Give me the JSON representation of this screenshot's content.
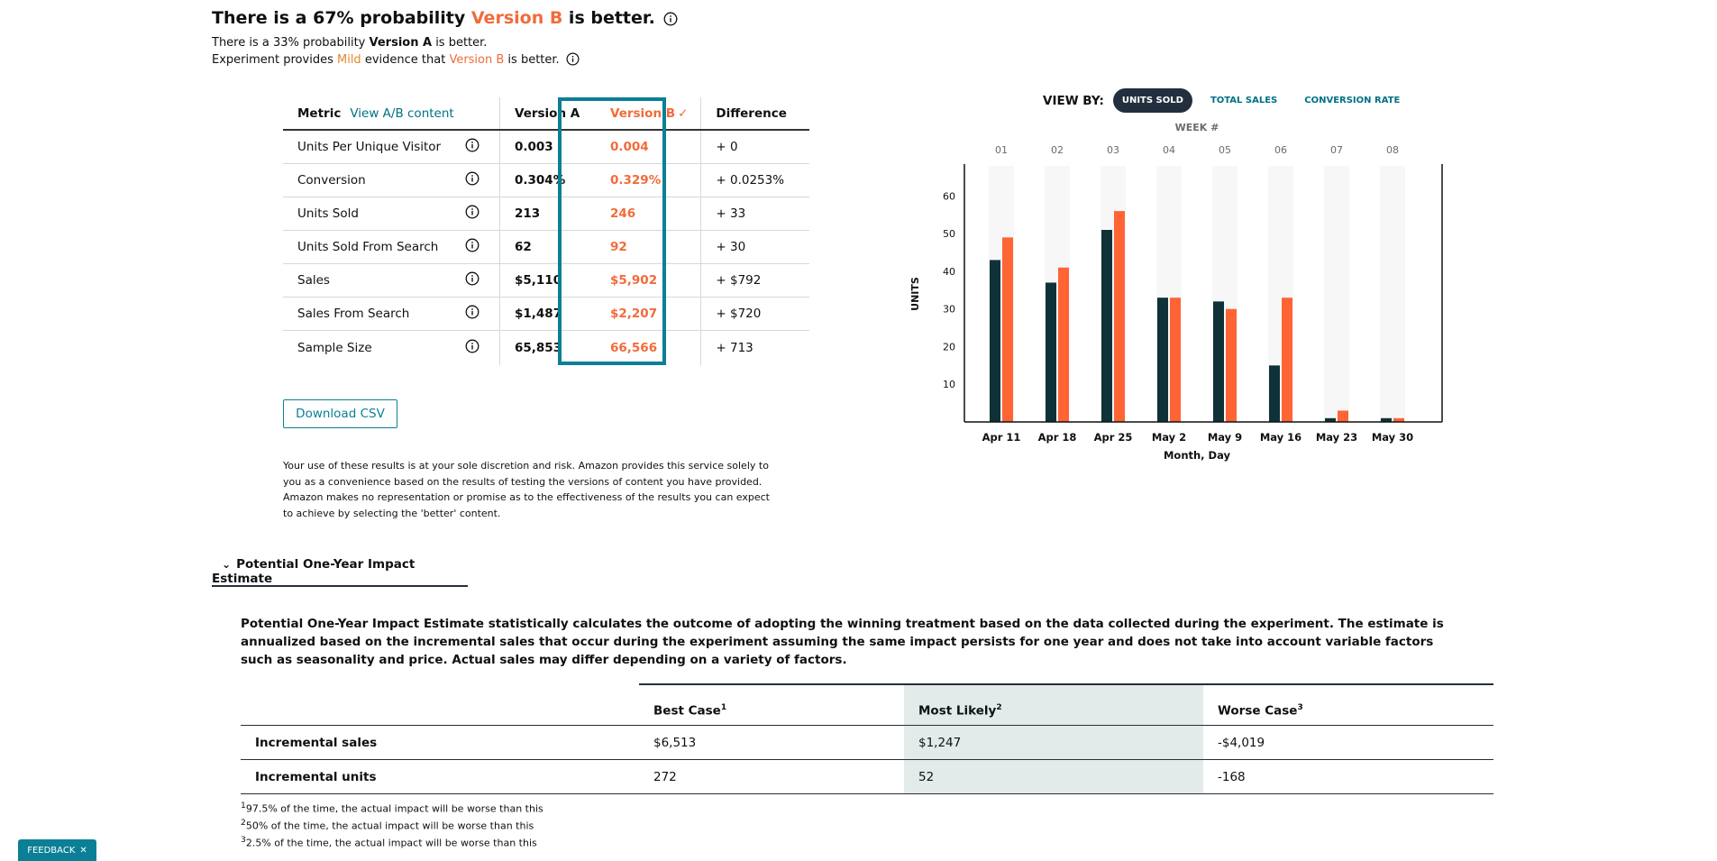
{
  "headline": {
    "part1": "There is a 67% probability ",
    "variant": "Version B",
    "part2": " is better."
  },
  "subline1": {
    "part1": "There is a 33% probability ",
    "variant": "Version A",
    "part2": " is better."
  },
  "subline2": {
    "part1": "Experiment provides ",
    "strength": "Mild",
    "part2": " evidence that ",
    "variant": "Version B",
    "part3": " is better."
  },
  "metrics": {
    "headers": {
      "metric": "Metric",
      "view_link": "View A/B content",
      "a": "Version A",
      "b": "Version B",
      "b_check": "✓",
      "diff": "Difference"
    },
    "rows": [
      {
        "name": "Units Per Unique Visitor",
        "a": "0.003",
        "b": "0.004",
        "diff": "+ 0"
      },
      {
        "name": "Conversion",
        "a": "0.304%",
        "b": "0.329%",
        "diff": "+ 0.0253%"
      },
      {
        "name": "Units Sold",
        "a": "213",
        "b": "246",
        "diff": "+ 33"
      },
      {
        "name": "Units Sold From Search",
        "a": "62",
        "b": "92",
        "diff": "+ 30"
      },
      {
        "name": "Sales",
        "a": "$5,110",
        "b": "$5,902",
        "diff": "+ $792"
      },
      {
        "name": "Sales From Search",
        "a": "$1,487",
        "b": "$2,207",
        "diff": "+ $720"
      },
      {
        "name": "Sample Size",
        "a": "65,853",
        "b": "66,566",
        "diff": "+ 713"
      }
    ]
  },
  "download_label": "Download CSV",
  "disclaimer": "Your use of these results is at your sole discretion and risk. Amazon provides this service solely to you as a convenience based on the results of testing the versions of content you have provided. Amazon makes no representation or promise as to the effectiveness of the results you can expect to achieve by selecting the 'better' content.",
  "view_by": {
    "label": "VIEW BY:",
    "options": [
      "UNITS SOLD",
      "TOTAL SALES",
      "CONVERSION RATE"
    ],
    "selected": "UNITS SOLD"
  },
  "colors": {
    "version_a": "#0e3238",
    "version_b": "#ff6435",
    "accent": "#0a7f96"
  },
  "chart_data": {
    "type": "bar",
    "top_axis_label": "WEEK #",
    "weeks": [
      "01",
      "02",
      "03",
      "04",
      "05",
      "06",
      "07",
      "08"
    ],
    "categories": [
      "Apr 11",
      "Apr 18",
      "Apr 25",
      "May 2",
      "May 9",
      "May 16",
      "May 23",
      "May 30"
    ],
    "series": [
      {
        "values": [
          43,
          37,
          51,
          33,
          32,
          15,
          1,
          1
        ]
      },
      {
        "values": [
          49,
          41,
          56,
          33,
          30,
          33,
          3,
          1
        ]
      }
    ],
    "xlabel": "Month, Day",
    "ylabel": "UNITS",
    "yticks": [
      10,
      20,
      30,
      40,
      50,
      60
    ],
    "ylim": [
      0,
      68
    ],
    "grid": false
  },
  "impact": {
    "toggle_label": "Potential One-Year Impact Estimate",
    "description": "Potential One-Year Impact Estimate statistically calculates the outcome of adopting the winning treatment based on the data collected during the experiment. The estimate is annualized based on the incremental sales that occur during the experiment assuming the same impact persists for one year and does not take into account variable factors such as seasonality and price. Actual sales may differ depending on a variety of factors.",
    "headers": [
      {
        "label": "Best Case",
        "sup": "1"
      },
      {
        "label": "Most Likely",
        "sup": "2"
      },
      {
        "label": "Worse Case",
        "sup": "3"
      }
    ],
    "rows": [
      {
        "label": "Incremental sales",
        "best": "$6,513",
        "likely": "$1,247",
        "worse": "-$4,019"
      },
      {
        "label": "Incremental units",
        "best": "272",
        "likely": "52",
        "worse": "-168"
      }
    ],
    "footnotes": [
      {
        "sup": "1",
        "text": "97.5% of the time, the actual impact will be worse than this"
      },
      {
        "sup": "2",
        "text": "50% of the time, the actual impact will be worse than this"
      },
      {
        "sup": "3",
        "text": "2.5% of the time, the actual impact will be worse than this"
      }
    ]
  },
  "feedback_label": "FEEDBACK",
  "feedback_close": "✕"
}
